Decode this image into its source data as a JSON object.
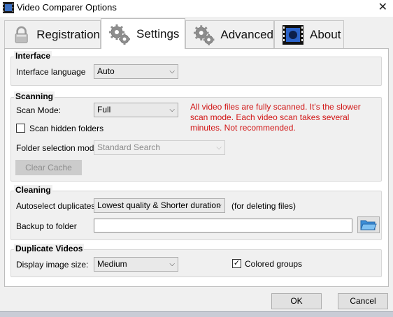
{
  "window": {
    "title": "Video Comparer Options",
    "close_glyph": "✕"
  },
  "tabs": [
    {
      "label": "Registration",
      "icon": "lock-icon"
    },
    {
      "label": "Settings",
      "icon": "gears-icon",
      "active": true
    },
    {
      "label": "Advanced",
      "icon": "gears-icon"
    },
    {
      "label": "About",
      "icon": "film-icon"
    }
  ],
  "interface": {
    "title": "Interface",
    "language_label": "Interface language",
    "language_value": "Auto"
  },
  "scanning": {
    "title": "Scanning",
    "scan_mode_label": "Scan Mode:",
    "scan_mode_value": "Full",
    "warning": "All video files are fully scanned. It's the slower scan mode. Each video scan takes several minutes. Not recommended.",
    "warning_color": "#d11414",
    "scan_hidden_label": "Scan hidden folders",
    "scan_hidden_checked": false,
    "folder_mode_label": "Folder selection mode:",
    "folder_mode_value": "Standard Search",
    "clear_cache_label": "Clear Cache"
  },
  "cleaning": {
    "title": "Cleaning",
    "autoselect_label": "Autoselect duplicates:",
    "autoselect_value": "Lowest quality & Shorter duration",
    "autoselect_note": "(for deleting files)",
    "backup_label": "Backup to folder",
    "backup_value": ""
  },
  "duplicates": {
    "title": "Duplicate Videos",
    "image_size_label": "Display image size:",
    "image_size_value": "Medium",
    "colored_groups_label": "Colored groups",
    "colored_groups_checked": true,
    "check_glyph": "✓"
  },
  "footer": {
    "ok_label": "OK",
    "cancel_label": "Cancel"
  },
  "glyphs": {
    "dropdown": "⌵"
  }
}
